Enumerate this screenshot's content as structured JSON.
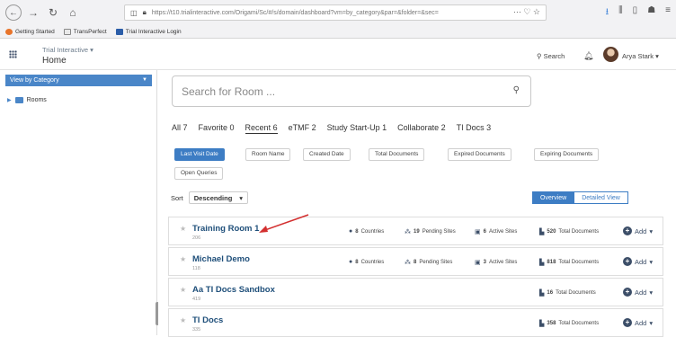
{
  "browser": {
    "url": "https://t10.trialinteractive.com/Origami/Sc/#/s/domain/dashboard?vm=by_category&par=&folder=&sec=",
    "url_tail": "··· ♡ ☆",
    "bookmarks": [
      "Getting Started",
      "TransPerfect",
      "Trial Interactive Login"
    ]
  },
  "app": {
    "name": "Trial Interactive",
    "page": "Home",
    "search_label": "Search",
    "user": "Arya Stark"
  },
  "sidebar": {
    "header": "View by Category",
    "items": [
      {
        "label": "Rooms"
      }
    ]
  },
  "main": {
    "search_placeholder": "Search for Room ...",
    "tabs": [
      "All 7",
      "Favorite 0",
      "Recent 6",
      "eTMF 2",
      "Study Start-Up 1",
      "Collaborate 2",
      "TI Docs 3"
    ],
    "active_tab": "Recent 6",
    "sort_chips": [
      "Last Visit Date",
      "Room Name",
      "Created Date",
      "Total Documents",
      "Expired Documents",
      "Expiring Documents",
      "Open Queries"
    ],
    "sort_label": "Sort",
    "sort_value": "Descending",
    "views": [
      "Overview",
      "Detailed View"
    ]
  },
  "rooms": [
    {
      "name": "Training Room 1",
      "sub": "206",
      "countries": "8",
      "pending_sites": "19",
      "active_sites": "6",
      "total_docs": "520",
      "add": "Add"
    },
    {
      "name": "Michael Demo",
      "sub": "118",
      "countries": "8",
      "pending_sites": "8",
      "active_sites": "3",
      "total_docs": "818",
      "add": "Add"
    },
    {
      "name": "Aa TI Docs Sandbox",
      "sub": "419",
      "total_docs": "16",
      "add": "Add"
    },
    {
      "name": "TI Docs",
      "sub": "335",
      "total_docs": "358",
      "add": "Add"
    }
  ],
  "labels": {
    "countries": "Countries",
    "pending_sites": "Pending Sites",
    "active_sites": "Active Sites",
    "total_docs": "Total Documents"
  },
  "colors": {
    "accent": "#3d7dc4",
    "annotation_arrow": "#d32f2f"
  }
}
